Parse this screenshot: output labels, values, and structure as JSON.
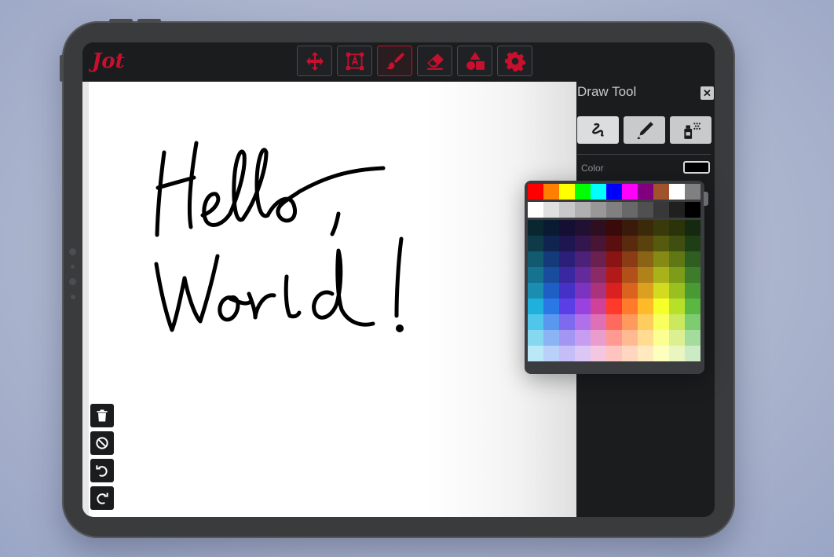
{
  "app": {
    "name": "Jot",
    "brand_color": "#c8102e"
  },
  "toolbar": {
    "tools": [
      {
        "icon": "move-icon",
        "active": false
      },
      {
        "icon": "text-icon",
        "active": false
      },
      {
        "icon": "brush-icon",
        "active": true
      },
      {
        "icon": "eraser-icon",
        "active": false
      },
      {
        "icon": "shapes-icon",
        "active": false
      },
      {
        "icon": "gear-icon",
        "active": false
      }
    ]
  },
  "canvas": {
    "drawing_text": "Hello, World!",
    "stroke_color": "#000000"
  },
  "side_tools": [
    {
      "icon": "trash-icon"
    },
    {
      "icon": "clear-icon"
    },
    {
      "icon": "undo-icon"
    },
    {
      "icon": "redo-icon"
    }
  ],
  "panel": {
    "title": "Draw Tool",
    "close_label": "✕",
    "brush_types": [
      {
        "icon": "pen-squiggle-icon",
        "selected": true
      },
      {
        "icon": "marker-icon",
        "selected": false
      },
      {
        "icon": "spray-can-icon",
        "selected": false
      }
    ],
    "color_label": "Color",
    "selected_color": "#000000"
  },
  "palette": {
    "top_row": [
      "#ff0000",
      "#ff7f00",
      "#ffff00",
      "#00ff00",
      "#00ffff",
      "#0000ff",
      "#ff00ff",
      "#800080",
      "#a0522d",
      "#ffffff",
      "#808080"
    ],
    "gray_row": [
      "#ffffff",
      "#e0e0e0",
      "#c8c8c8",
      "#b0b0b0",
      "#989898",
      "#808080",
      "#686868",
      "#505050",
      "#383838",
      "#202020",
      "#000000"
    ],
    "grid": [
      [
        "#0a2730",
        "#0a1a33",
        "#150f33",
        "#221033",
        "#2e0f22",
        "#3a0a0a",
        "#3a1a0a",
        "#3a2a0a",
        "#383a0a",
        "#2a330a",
        "#14290f"
      ],
      [
        "#0f3a48",
        "#0f2550",
        "#1e1650",
        "#33164e",
        "#461634",
        "#5a0f0f",
        "#5a2a0f",
        "#5a420f",
        "#565a0f",
        "#3f4f0f",
        "#1e3f16"
      ],
      [
        "#125a70",
        "#143a7a",
        "#2c1f7a",
        "#4c2178",
        "#6a214f",
        "#8a1414",
        "#8a3d14",
        "#8a6414",
        "#848a14",
        "#5f7814",
        "#2e5f21"
      ],
      [
        "#16738f",
        "#1a4c9e",
        "#3a28a0",
        "#642a9c",
        "#8a2a66",
        "#b21a1a",
        "#b2501a",
        "#b2821a",
        "#aab21a",
        "#7c9c1a",
        "#3c7c2a"
      ],
      [
        "#1a8db0",
        "#1f5ec4",
        "#4631c6",
        "#7c33c0",
        "#ab337e",
        "#db2020",
        "#db6320",
        "#dba020",
        "#d2db20",
        "#99c020",
        "#4a9a33"
      ],
      [
        "#1fb0db",
        "#2a78e6",
        "#5a3ee6",
        "#9a42e0",
        "#d0429a",
        "#ff3a2a",
        "#ff7a2a",
        "#ffba2a",
        "#f6ff2a",
        "#b6e02a",
        "#5ab842"
      ],
      [
        "#50c6ea",
        "#5a97ee",
        "#7d6aee",
        "#b070ea",
        "#e070b6",
        "#ff6a5e",
        "#ff9a5e",
        "#ffcc5e",
        "#f9ff5e",
        "#cbe95e",
        "#7dcc70"
      ],
      [
        "#85d8f0",
        "#8ab4f3",
        "#a197f3",
        "#c69df0",
        "#ea9dcc",
        "#ff9a92",
        "#ffba92",
        "#ffdc92",
        "#fbff92",
        "#dcf092",
        "#a4dc9d"
      ],
      [
        "#b9e9f6",
        "#b9d1f8",
        "#c5bdf8",
        "#dcc6f6",
        "#f3c6e1",
        "#ffc4bf",
        "#ffd6bf",
        "#ffeabf",
        "#fdffbf",
        "#eaf6bf",
        "#cbebc6"
      ]
    ]
  }
}
